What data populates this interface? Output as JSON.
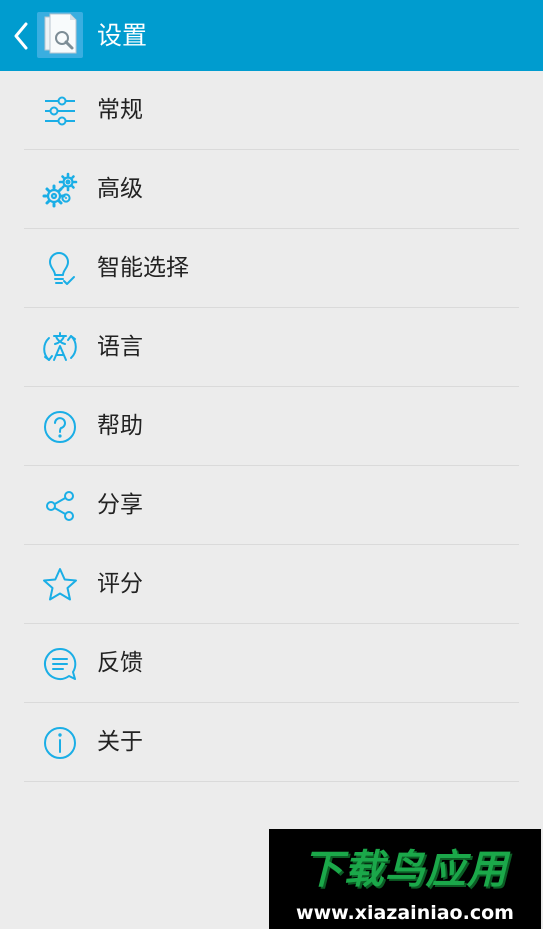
{
  "header": {
    "title": "设置",
    "accent_color": "#009ccf",
    "back_icon": "chevron-left-icon",
    "app_icon": "document-search-icon"
  },
  "menu": [
    {
      "label": "常规",
      "icon": "sliders-icon"
    },
    {
      "label": "高级",
      "icon": "gears-icon"
    },
    {
      "label": "智能选择",
      "icon": "lightbulb-icon"
    },
    {
      "label": "语言",
      "icon": "translate-icon"
    },
    {
      "label": "帮助",
      "icon": "question-circle-icon"
    },
    {
      "label": "分享",
      "icon": "share-icon"
    },
    {
      "label": "评分",
      "icon": "star-icon"
    },
    {
      "label": "反馈",
      "icon": "feedback-bubble-icon"
    },
    {
      "label": "关于",
      "icon": "info-circle-icon"
    }
  ],
  "icon_color": "#1aaee6",
  "watermark": {
    "brand": "下载鸟应用",
    "url": "www.xiazainiao.com"
  }
}
